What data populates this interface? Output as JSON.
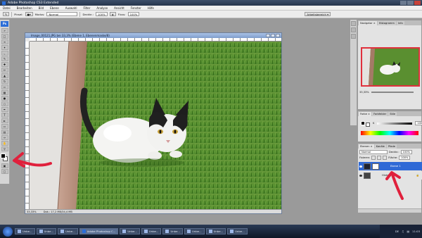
{
  "app": {
    "title": "Adobe Photoshop CS3 Extended"
  },
  "menu": [
    "Datei",
    "Bearbeiten",
    "Bild",
    "Ebene",
    "Auswahl",
    "Filter",
    "Analyse",
    "Ansicht",
    "Fenster",
    "Hilfe"
  ],
  "options": {
    "pinsel_label": "Pinsel:",
    "modus_label": "Modus:",
    "modus_value": "Normal",
    "deckkr_label": "Deckkr.:",
    "deckkr_value": "100%",
    "fluss_label": "Fluss:",
    "fluss_value": "100%",
    "workspace_button": "Arbeitsbereich ▾"
  },
  "toolbox": {
    "logo": "Ps"
  },
  "document": {
    "title": "Image_00121.JPG bei 33,3% (Ebene 1, Ebenenmaske/8)",
    "status_zoom": "33,33%",
    "status_doc": "Dok.: 17,2 MB/34,4 MB"
  },
  "navigator": {
    "tabs": [
      "Navigator ×",
      "Histogramm",
      "Info"
    ],
    "zoom": "33,33%"
  },
  "color_panel": {
    "tabs": [
      "Farbe ×",
      "Farbfelder",
      "Stile"
    ],
    "k_label": "K",
    "k_value": "100",
    "k_unit": "%"
  },
  "layers": {
    "tabs": [
      "Ebenen ×",
      "Kanäle",
      "Pfade"
    ],
    "blend_mode": "Normal",
    "opacity_label": "Deckkr.:",
    "opacity_value": "100%",
    "fixieren_label": "Fixieren:",
    "flaeche_label": "Fläche:",
    "flaeche_value": "100%",
    "items": [
      {
        "name": "Ebene 1"
      },
      {
        "name": "Hintergrund"
      }
    ]
  },
  "taskbar": {
    "tasks": [
      "Unbe...",
      "Unbe...",
      "Unbe...",
      "Adobe Photoshop C...",
      "Unbe...",
      "Unbe...",
      "Unbe...",
      "Unbe...",
      "Unbe...",
      "Unbe..."
    ],
    "language": "DE",
    "clock": "11:03"
  },
  "colors": {
    "accent": "#2f69d6",
    "annotation": "#e0203c"
  }
}
